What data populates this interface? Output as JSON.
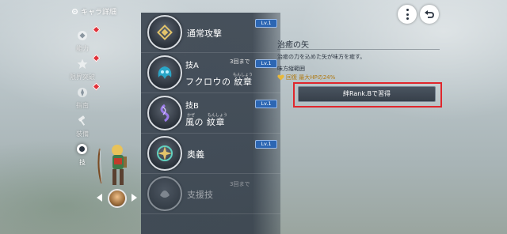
{
  "header": {
    "title": "キャラ詳細"
  },
  "side_menu": {
    "items": [
      {
        "label": "能力",
        "icon": "gear-diamond-icon",
        "badge": true
      },
      {
        "label": "限界突破",
        "icon": "star-icon",
        "badge": true
      },
      {
        "label": "指南",
        "icon": "compass-icon",
        "badge": true
      },
      {
        "label": "装備",
        "icon": "hammer-icon",
        "badge": false
      },
      {
        "label": "技",
        "icon": "skill-circle-icon",
        "badge": false,
        "active": true
      }
    ]
  },
  "skills": [
    {
      "name": "通常攻撃",
      "level": "Lv.1",
      "icon": "diamond-emblem-icon"
    },
    {
      "sub": "技A",
      "name": "フクロウの 紋章",
      "ruby_word": "もんしょう",
      "uses": "3回まで",
      "level": "Lv.1",
      "icon": "owl-emblem-icon"
    },
    {
      "sub": "技B",
      "name": "風の 紋章",
      "ruby_kaze": "かぜ",
      "ruby_word": "もんしょう",
      "level": "Lv.1",
      "icon": "wind-emblem-icon"
    },
    {
      "name": "奥義",
      "level": "Lv.1",
      "icon": "ougi-emblem-icon"
    },
    {
      "name": "支援技",
      "uses": "3回まで",
      "icon": "support-emblem-icon",
      "disabled": true
    }
  ],
  "detail": {
    "title": "治癒の矢",
    "description": "治癒の力を込めた矢が味方を癒す。",
    "range": "味方縦範囲",
    "effect": "回復 最大HPの24%",
    "learn_button": "絆Rank.Bで習得"
  },
  "colors": {
    "panel": "#3a4450",
    "level_badge": "#2c66b3",
    "highlight_frame": "#e0262c",
    "effect_text": "#b07a12",
    "badge_dot": "#e0323a"
  }
}
